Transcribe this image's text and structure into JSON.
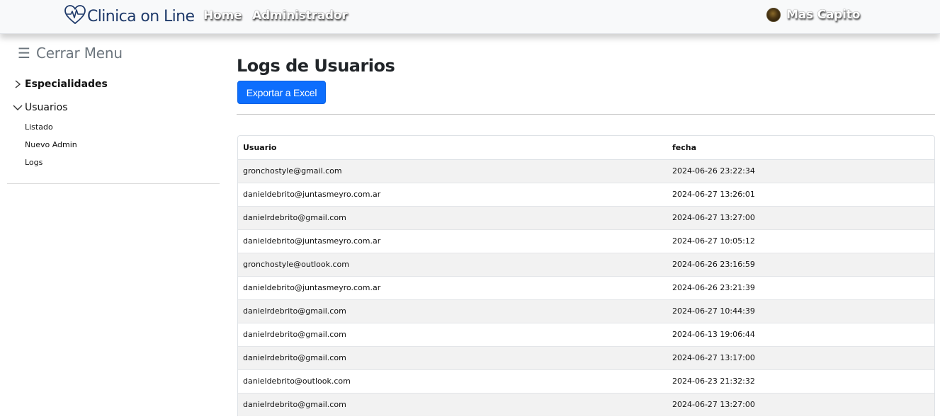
{
  "navbar": {
    "brand": "Clinica on Line",
    "links": [
      "Home",
      "Administrador"
    ],
    "user_name": "Mas Capito"
  },
  "sidebar": {
    "toggle_label": "Cerrar Menu",
    "items": [
      {
        "label": "Especialidades",
        "expanded": false
      },
      {
        "label": "Usuarios",
        "expanded": true,
        "children": [
          "Listado",
          "Nuevo Admin",
          "Logs"
        ]
      }
    ]
  },
  "main": {
    "title": "Logs de Usuarios",
    "export_button": "Exportar a Excel",
    "table": {
      "columns": [
        "Usuario",
        "fecha"
      ],
      "rows": [
        [
          "gronchostyle@gmail.com",
          "2024-06-26 23:22:34"
        ],
        [
          "danieldebrito@juntasmeyro.com.ar",
          "2024-06-27 13:26:01"
        ],
        [
          "danielrdebrito@gmail.com",
          "2024-06-27 13:27:00"
        ],
        [
          "danieldebrito@juntasmeyro.com.ar",
          "2024-06-27 10:05:12"
        ],
        [
          "gronchostyle@outlook.com",
          "2024-06-26 23:16:59"
        ],
        [
          "danieldebrito@juntasmeyro.com.ar",
          "2024-06-26 23:21:39"
        ],
        [
          "danielrdebrito@gmail.com",
          "2024-06-27 10:44:39"
        ],
        [
          "danielrdebrito@gmail.com",
          "2024-06-13 19:06:44"
        ],
        [
          "danielrdebrito@gmail.com",
          "2024-06-27 13:17:00"
        ],
        [
          "danieldebrito@outlook.com",
          "2024-06-23 21:32:32"
        ],
        [
          "danielrdebrito@gmail.com",
          "2024-06-27 13:27:00"
        ]
      ]
    }
  },
  "colors": {
    "navbar_bg": "#f8f9fa",
    "brand": "#1f3a6a",
    "primary_button": "#0d6efd",
    "striped_row": "#f2f2f2"
  },
  "icons": [
    "heart-pulse-icon",
    "hamburger-icon",
    "chevron-right-icon",
    "chevron-down-icon",
    "avatar"
  ]
}
